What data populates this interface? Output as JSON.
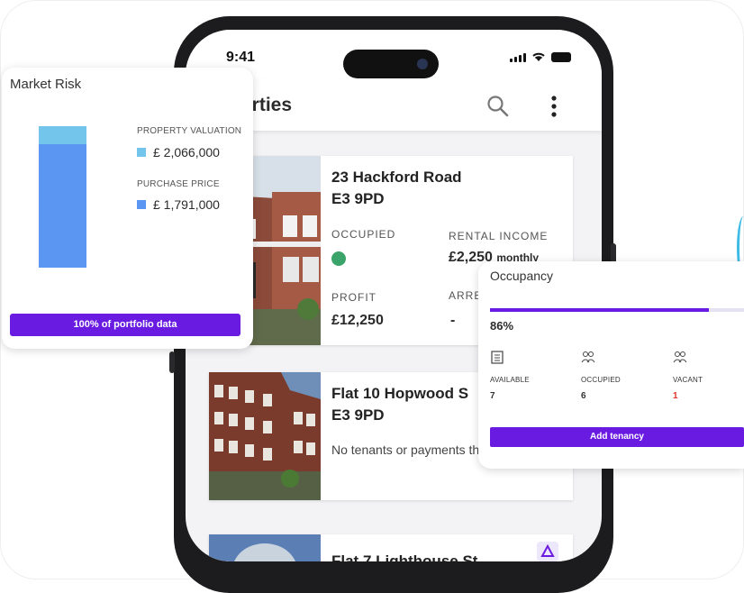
{
  "status_bar": {
    "time": "9:41"
  },
  "app_header": {
    "title": "erties"
  },
  "properties": [
    {
      "address_line1": "23 Hackford Road",
      "address_line2": "E3 9PD",
      "status_label": "OCCUPIED",
      "status_color": "#3aa46a",
      "rental_income_label": "RENTAL INCOME",
      "rental_income_value": "£2,250",
      "rental_income_period": "monthly",
      "profit_label": "PROFIT",
      "profit_value": "£12,250",
      "arrears_label": "ARRE",
      "arrears_value": "-"
    },
    {
      "address_line1": "Flat 10 Hopwood S",
      "address_line2": "E3 9PD",
      "note": "No tenants or payments this property"
    },
    {
      "address_line1": "Flat 7 Lighthouse St"
    }
  ],
  "market_risk": {
    "title": "Market Risk",
    "valuation_label": "PROPERTY VALUATION",
    "valuation_value": "£ 2,066,000",
    "valuation_color": "#73c5eb",
    "purchase_label": "PURCHASE PRICE",
    "purchase_value": "£ 1,791,000",
    "purchase_color": "#5b96f2",
    "button_label": "100% of portfolio data"
  },
  "occupancy": {
    "title": "Occupancy",
    "percent_label": "86%",
    "percent_value": 86,
    "columns": [
      {
        "label": "AVAILABLE",
        "value": "7",
        "icon": "building-icon"
      },
      {
        "label": "OCCUPIED",
        "value": "6",
        "icon": "tenants-icon"
      },
      {
        "label": "VACANT",
        "value": "1",
        "icon": "tenants-icon"
      }
    ],
    "vacant_color": "#e0322b",
    "button_label": "Add tenancy"
  },
  "colors": {
    "accent": "#6a1be2"
  }
}
